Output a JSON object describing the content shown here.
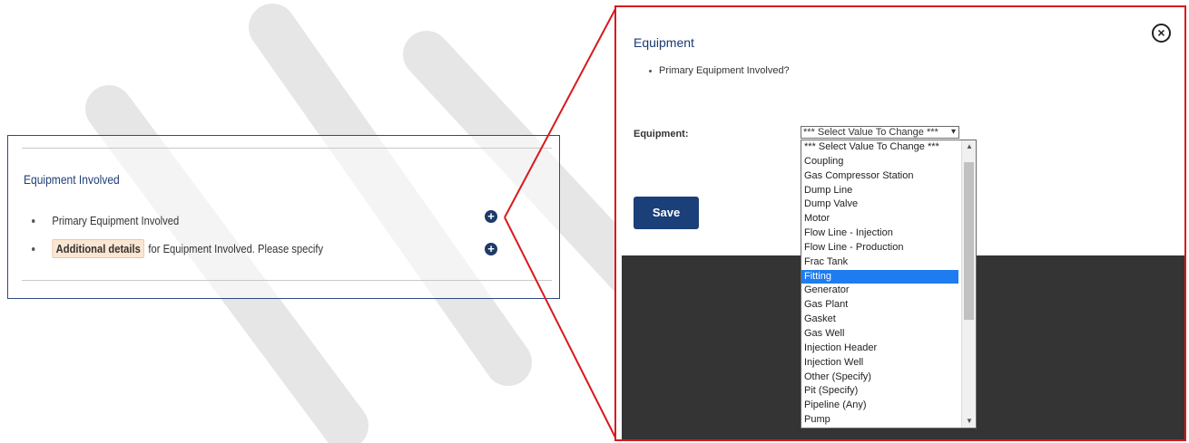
{
  "left_panel": {
    "section_title": "Equipment Involved",
    "items": [
      {
        "label": "Primary Equipment Involved"
      },
      {
        "highlight": "Additional details",
        "label": "for Equipment Involved. Please specify"
      }
    ]
  },
  "dialog": {
    "title": "Equipment",
    "bullet": "Primary Equipment Involved?",
    "field_label": "Equipment:",
    "select_value": "*** Select Value To Change ***",
    "options": [
      "*** Select Value To Change ***",
      "Coupling",
      "Gas Compressor Station",
      "Dump Line",
      "Dump Valve",
      "Motor",
      "Flow Line - Injection",
      "Flow Line - Production",
      "Frac Tank",
      "Fitting",
      "Generator",
      "Gas Plant",
      "Gasket",
      "Gas Well",
      "Injection Header",
      "Injection Well",
      "Other (Specify)",
      "Pit (Specify)",
      "Pipeline (Any)",
      "Pump"
    ],
    "selected_option": "Fitting",
    "save_label": "Save"
  },
  "colors": {
    "accent_navy": "#1b3f78",
    "highlight_red": "#d7191c",
    "selected_blue": "#1e7cf0"
  },
  "icons": [
    "plus-circle-icon",
    "close-circle-icon",
    "chevron-down-icon"
  ]
}
